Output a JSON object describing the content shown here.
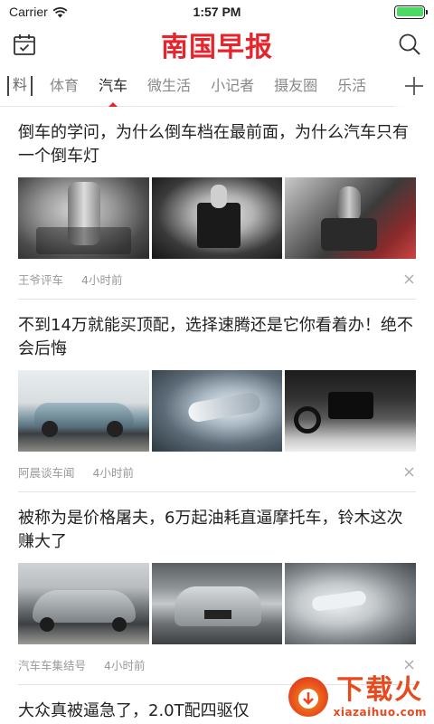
{
  "status_bar": {
    "carrier": "Carrier",
    "time": "1:57 PM"
  },
  "header": {
    "title": "南国早报"
  },
  "tabs": {
    "special": "料",
    "items": [
      "体育",
      "汽车",
      "微生活",
      "小记者",
      "摄友圈",
      "乐活"
    ],
    "active": "汽车"
  },
  "articles": [
    {
      "title": "倒车的学问，为什么倒车档在最前面，为什么汽车只有一个倒车灯",
      "source": "王爷评车",
      "time": "4小时前"
    },
    {
      "title": "不到14万就能买顶配，选择速腾还是它你看着办！绝不会后悔",
      "source": "阿晨谈车闻",
      "time": "4小时前"
    },
    {
      "title": "被称为是价格屠夫，6万起油耗直逼摩托车，铃木这次赚大了",
      "source": "汽车车集结号",
      "time": "4小时前"
    },
    {
      "title": "大众真被逼急了，2.0T配四驱仅"
    }
  ],
  "watermark": {
    "cn": "下载火",
    "en": "xiazaihuo.com"
  },
  "colors": {
    "accent": "#e7242c",
    "watermark": "#e8491d"
  }
}
